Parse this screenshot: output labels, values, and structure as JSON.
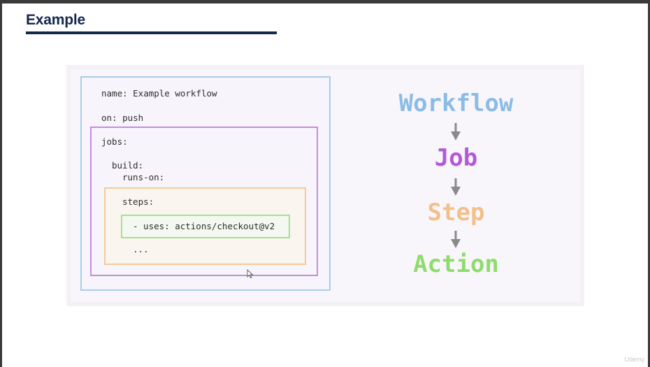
{
  "slide": {
    "title": "Example"
  },
  "code": {
    "line_name": "name: Example workflow",
    "line_on": "on: push",
    "line_jobs": "jobs:",
    "line_build": "build:",
    "line_runs_on": "runs-on:",
    "line_steps": "steps:",
    "line_uses": "- uses: actions/checkout@v2",
    "line_ellipsis": "..."
  },
  "hierarchy": {
    "workflow": "Workflow",
    "job": "Job",
    "step": "Step",
    "action": "Action"
  },
  "colors": {
    "workflow": "#8cbce6",
    "job": "#b25ad6",
    "step": "#f2c08a",
    "action": "#8fdc6c",
    "arrow": "#8a8a8a",
    "title": "#15284b"
  },
  "icons": {
    "arrow": "arrow-down-icon",
    "cursor": "mouse-pointer-icon"
  },
  "watermark": "Udemy"
}
